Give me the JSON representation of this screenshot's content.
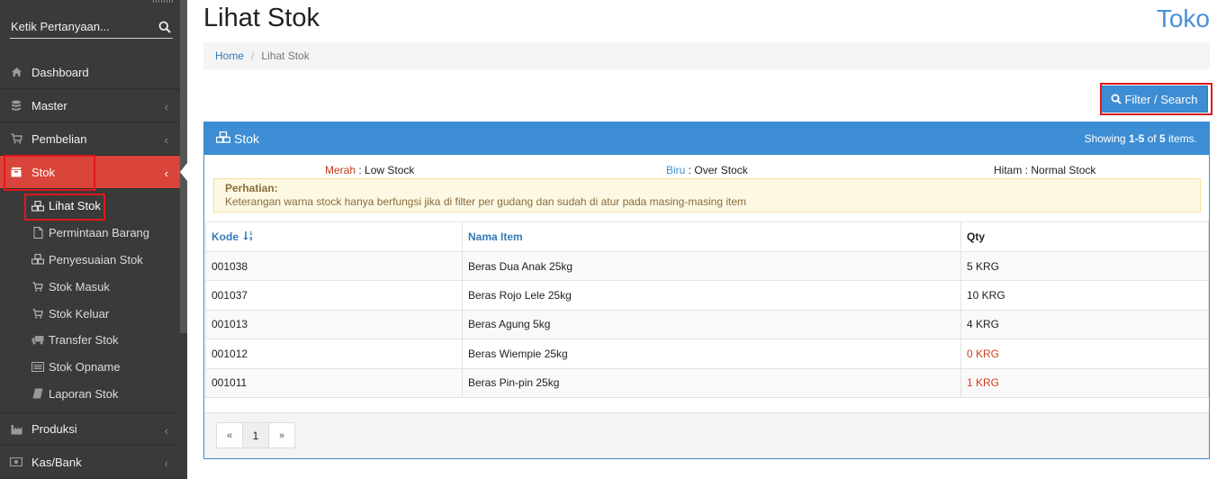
{
  "sidebar": {
    "search_placeholder": "Ketik Pertanyaan...",
    "menu": [
      {
        "label": "Dashboard"
      },
      {
        "label": "Master"
      },
      {
        "label": "Pembelian"
      },
      {
        "label": "Stok"
      },
      {
        "label": "Produksi"
      },
      {
        "label": "Kas/Bank"
      }
    ],
    "submenu": [
      {
        "label": "Lihat Stok"
      },
      {
        "label": "Permintaan Barang"
      },
      {
        "label": "Penyesuaian Stok"
      },
      {
        "label": "Stok Masuk"
      },
      {
        "label": "Stok Keluar"
      },
      {
        "label": "Transfer Stok"
      },
      {
        "label": "Stok Opname"
      },
      {
        "label": "Laporan Stok"
      }
    ]
  },
  "header": {
    "title": "Lihat Stok",
    "brand": "Toko"
  },
  "breadcrumb": {
    "home": "Home",
    "separator": "/",
    "current": "Lihat Stok"
  },
  "toolbar": {
    "filter_label": "Filter / Search"
  },
  "panel": {
    "title": "Stok",
    "summary_prefix": "Showing ",
    "summary_range": "1-5",
    "summary_of": " of ",
    "summary_total": "5",
    "summary_suffix": " items.",
    "legend": [
      {
        "key": "Merah",
        "sep": " : ",
        "text": "Low Stock",
        "color": "#c0391b"
      },
      {
        "key": "Biru",
        "sep": " : ",
        "text": "Over Stock",
        "color": "#3c8dd3"
      },
      {
        "key": "Hitam",
        "sep": " : ",
        "text": "Normal Stock",
        "color": "#222222"
      }
    ],
    "notice_title": "Perhatian:",
    "notice_text": "Keterangan warna stock hanya berfungsi jika di filter per gudang dan sudah di atur pada masing-masing item"
  },
  "table": {
    "columns": [
      "Kode",
      "Nama Item",
      "Qty"
    ],
    "rows": [
      {
        "kode": "001038",
        "nama": "Beras Dua Anak 25kg",
        "qty": "5 KRG"
      },
      {
        "kode": "001037",
        "nama": "Beras Rojo Lele 25kg",
        "qty": "10 KRG"
      },
      {
        "kode": "001013",
        "nama": "Beras Agung 5kg",
        "qty": "4 KRG"
      },
      {
        "kode": "001012",
        "nama": "Beras Wiempie 25kg",
        "qty": "0 KRG"
      },
      {
        "kode": "001011",
        "nama": "Beras Pin-pin 25kg",
        "qty": "1 KRG"
      }
    ]
  },
  "pagination": {
    "prev": "«",
    "page": "1",
    "next": "»"
  },
  "colors": {
    "sidebar_bg": "#3a3a3a",
    "active": "#d9453a",
    "primary": "#3c8dd3",
    "low_stock": "#d23c1e"
  }
}
